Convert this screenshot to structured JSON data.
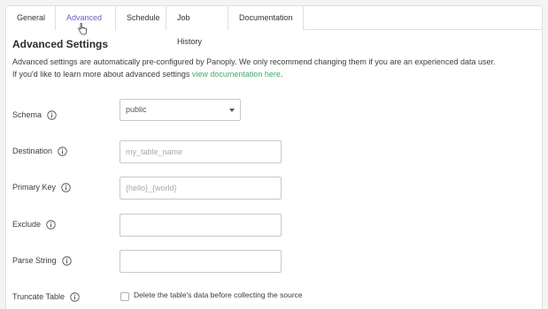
{
  "tabs": [
    {
      "label": "General"
    },
    {
      "label": "Advanced"
    },
    {
      "label": "Schedule"
    },
    {
      "label": "Job History"
    },
    {
      "label": "Documentation"
    }
  ],
  "active_tab": "Advanced",
  "section": {
    "title": "Advanced Settings",
    "desc_line1": "Advanced settings are automatically pre-configured by Panoply. We only recommend changing them if you are an experienced data user.",
    "desc_line2_prefix": "If you'd like to learn more about advanced settings ",
    "desc_link": "view documentation here",
    "desc_line2_suffix": "."
  },
  "fields": {
    "schema": {
      "label": "Schema",
      "value": "public"
    },
    "destination": {
      "label": "Destination",
      "placeholder": "my_table_name"
    },
    "primary_key": {
      "label": "Primary Key",
      "placeholder": "{hello}_{world}"
    },
    "exclude": {
      "label": "Exclude",
      "placeholder": ""
    },
    "parse_string": {
      "label": "Parse String",
      "placeholder": ""
    },
    "truncate_table": {
      "label": "Truncate Table",
      "checkbox_label": "Delete the table's data before collecting the source",
      "checked": false
    }
  },
  "colors": {
    "accent": "#6a5dc4",
    "link": "#45a86a"
  },
  "icons": {
    "info": "info-circle-icon",
    "cursor": "hand-pointer-icon",
    "caret": "caret-down-icon"
  }
}
